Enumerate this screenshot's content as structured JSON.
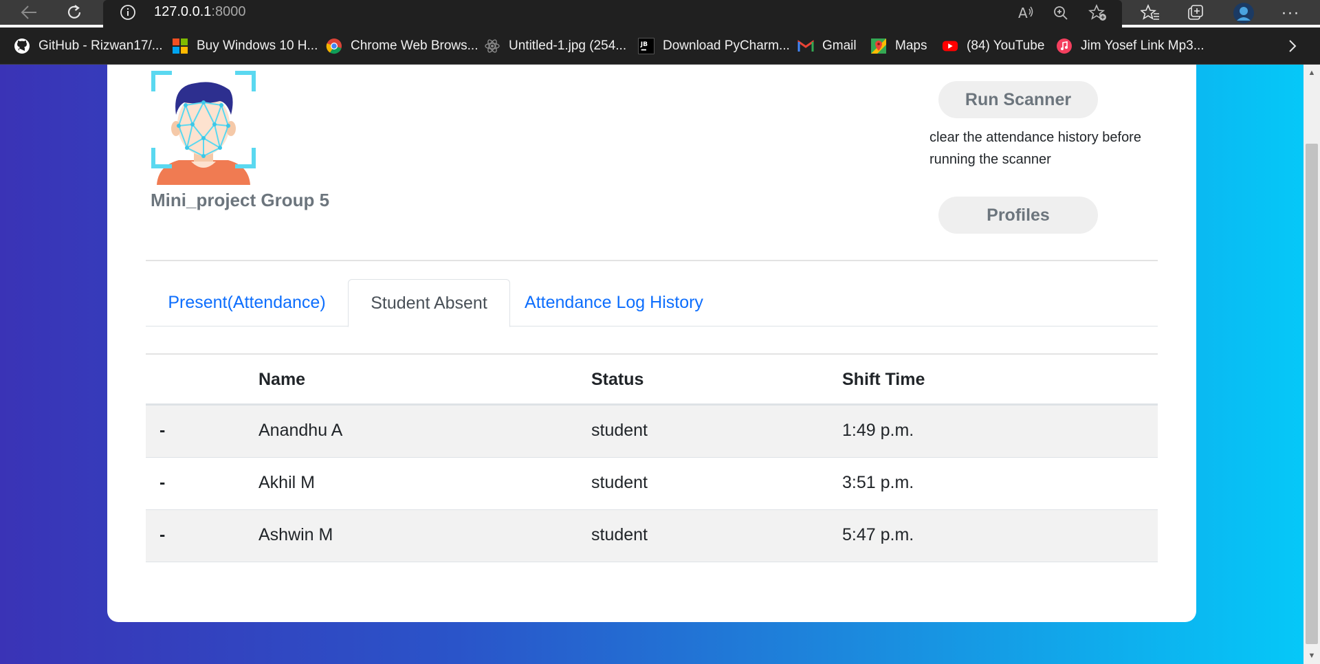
{
  "browser": {
    "address": {
      "host": "127.0.0.1",
      "port": ":8000"
    },
    "bookmarks": [
      {
        "label": "GitHub - Rizwan17/...",
        "icon": "github-icon"
      },
      {
        "label": "Buy Windows 10 H...",
        "icon": "windows-logo-icon"
      },
      {
        "label": "Chrome Web Brows...",
        "icon": "chrome-icon"
      },
      {
        "label": "Untitled-1.jpg (254...",
        "icon": "atom-icon"
      },
      {
        "label": "Download PyCharm...",
        "icon": "jetbrains-icon"
      },
      {
        "label": "Gmail",
        "icon": "gmail-icon"
      },
      {
        "label": "Maps",
        "icon": "maps-icon"
      },
      {
        "label": "(84) YouTube",
        "icon": "youtube-icon"
      },
      {
        "label": "Jim Yosef Link Mp3...",
        "icon": "music-icon"
      }
    ]
  },
  "header": {
    "group_name": "Mini_project Group 5",
    "run_scanner_label": "Run Scanner",
    "hint_line1": "clear the attendance history before",
    "hint_line2": "running the scanner",
    "profiles_label": "Profiles"
  },
  "tabs": [
    {
      "label": "Present(Attendance)",
      "active": false
    },
    {
      "label": "Student Absent",
      "active": true
    },
    {
      "label": "Attendance Log History",
      "active": false
    }
  ],
  "table": {
    "headers": {
      "col0": "",
      "name": "Name",
      "status": "Status",
      "shift": "Shift Time"
    },
    "rows": [
      {
        "marker": "-",
        "name": "Anandhu A",
        "status": "student",
        "shift": "1:49 p.m."
      },
      {
        "marker": "-",
        "name": "Akhil M",
        "status": "student",
        "shift": "3:51 p.m."
      },
      {
        "marker": "-",
        "name": "Ashwin M",
        "status": "student",
        "shift": "5:47 p.m."
      }
    ]
  },
  "colors": {
    "link": "#0d6efd",
    "muted": "#6c757d",
    "gradient_start": "#3a33b6",
    "gradient_end": "#05c8f8"
  }
}
